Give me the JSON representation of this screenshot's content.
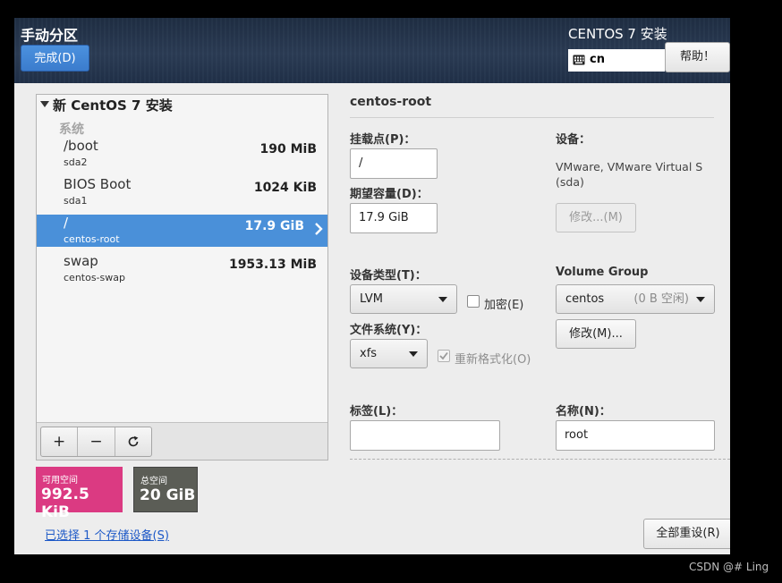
{
  "header": {
    "title": "手动分区",
    "done_label": "完成(D)",
    "product_title": "CENTOS 7 安装",
    "keyboard_layout": "cn",
    "help_label": "帮助！"
  },
  "tree": {
    "root_label": "新 CentOS 7 安装",
    "system_label": "系统",
    "partitions": [
      {
        "name": "/boot",
        "device": "sda2",
        "size": "190 MiB"
      },
      {
        "name": "BIOS Boot",
        "device": "sda1",
        "size": "1024 KiB"
      },
      {
        "name": "/",
        "device": "centos-root",
        "size": "17.9 GiB",
        "selected": true
      },
      {
        "name": "swap",
        "device": "centos-swap",
        "size": "1953.13 MiB"
      }
    ],
    "toolbar": {
      "add": "+",
      "remove": "−"
    }
  },
  "space": {
    "available_label": "可用空间",
    "available_value": "992.5 KiB",
    "total_label": "总空间",
    "total_value": "20 GiB"
  },
  "storage_link": "已选择 1 个存储设备(S)",
  "details": {
    "title": "centos-root",
    "mount_point_label": "挂载点(P)：",
    "mount_point_value": "/",
    "capacity_label": "期望容量(D)：",
    "capacity_value": "17.9 GiB",
    "device_label": "设备：",
    "device_desc_line1": "VMware, VMware Virtual S",
    "device_desc_line2": "(sda)",
    "modify_device_label": "修改...(M)",
    "device_type_label": "设备类型(T)：",
    "device_type_value": "LVM",
    "encrypt_label": "加密(E)",
    "volume_group_label": "Volume Group",
    "volume_group_value": "centos",
    "volume_group_free": "(0 B 空闲)",
    "modify_vg_label": "修改(M)...",
    "filesystem_label": "文件系统(Y)：",
    "filesystem_value": "xfs",
    "reformat_label": "重新格式化(O)",
    "tag_label": "标签(L)：",
    "tag_value": "",
    "name_label": "名称(N)：",
    "name_value": "root"
  },
  "reset_all_label": "全部重设(R)",
  "watermark": "CSDN @#  Ling"
}
